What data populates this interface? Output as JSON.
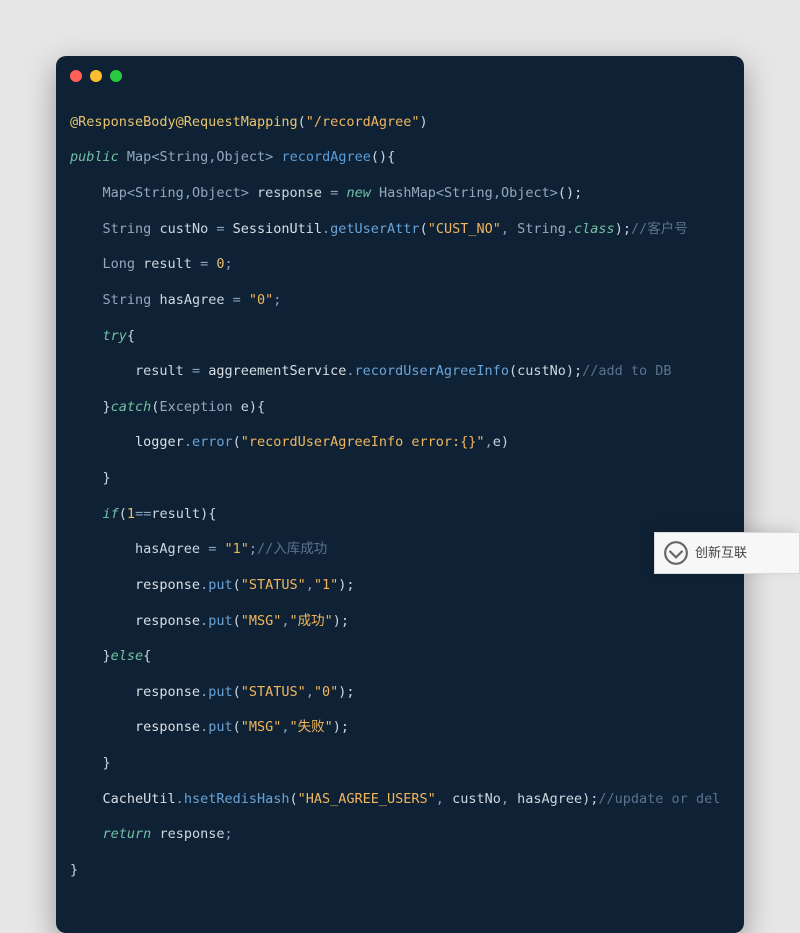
{
  "traffic_light_colors": {
    "red": "#ff5f56",
    "yellow": "#ffbd2e",
    "green": "#27c93f"
  },
  "code": {
    "l1": {
      "ann1": "@ResponseBody",
      "ann2": "@RequestMapping",
      "lp": "(",
      "str": "\"/recordAgree\"",
      "rp": ")"
    },
    "l2": {
      "pub": "public",
      "sp1": " ",
      "t1": "Map",
      "g1": "<",
      "t2": "String",
      "c1": ",",
      "t3": "Object",
      "g2": ">",
      "sp2": " ",
      "name": "recordAgree",
      "pp": "(){"
    },
    "l3": {
      "ind": "    ",
      "t1": "Map",
      "g1": "<",
      "t2": "String",
      "c1": ",",
      "t3": "Object",
      "g2": ">",
      "sp": " ",
      "v": "response",
      "eq": " = ",
      "nw": "new",
      "sp2": " ",
      "t4": "HashMap",
      "g3": "<",
      "t5": "String",
      "c2": ",",
      "t6": "Object",
      "g4": ">",
      "tail": "();"
    },
    "l4": {
      "ind": "    ",
      "t": "String",
      "sp": " ",
      "v": "custNo",
      "eq": " = ",
      "obj": "SessionUtil",
      "dot": ".",
      "call": "getUserAttr",
      "lp": "(",
      "s": "\"CUST_NO\"",
      "c": ", ",
      "t2": "String",
      "dot2": ".",
      "cl": "class",
      "rp": ");",
      "cmt": "//客户号"
    },
    "l5": {
      "ind": "    ",
      "t": "Long",
      "sp": " ",
      "v": "result",
      "eq": " = ",
      "n": "0",
      "sc": ";"
    },
    "l6": {
      "ind": "    ",
      "t": "String",
      "sp": " ",
      "v": "hasAgree",
      "eq": " = ",
      "s": "\"0\"",
      "sc": ";"
    },
    "l7": {
      "ind": "    ",
      "try": "try",
      "br": "{"
    },
    "l8": {
      "ind": "        ",
      "v": "result",
      "eq": " = ",
      "obj": "aggreementService",
      "dot": ".",
      "call": "recordUserAgreeInfo",
      "lp": "(",
      "arg": "custNo",
      "rp": ");",
      "cmt": "//add to DB"
    },
    "l9": {
      "ind": "    ",
      "rc": "}",
      "ct": "catch",
      "lp": "(",
      "t": "Exception",
      "sp": " ",
      "v": "e",
      "rp": "){"
    },
    "l10": {
      "ind": "        ",
      "obj": "logger",
      "dot": ".",
      "call": "error",
      "lp": "(",
      "s": "\"recordUserAgreeInfo error:{}\"",
      "c": ",",
      "arg": "e",
      "rp": ")"
    },
    "l11": {
      "ind": "    ",
      "br": "}"
    },
    "l12": {
      "ind": "    ",
      "if": "if",
      "lp": "(",
      "n": "1",
      "eq": "==",
      "v": "result",
      "rp": "){"
    },
    "l13": {
      "ind": "        ",
      "v": "hasAgree",
      "eq": " = ",
      "s": "\"1\"",
      "sc": ";",
      "cmt": "//入库成功"
    },
    "l14": {
      "ind": "        ",
      "obj": "response",
      "dot": ".",
      "call": "put",
      "lp": "(",
      "s1": "\"STATUS\"",
      "c": ",",
      "s2": "\"1\"",
      "rp": ");"
    },
    "l15": {
      "ind": "        ",
      "obj": "response",
      "dot": ".",
      "call": "put",
      "lp": "(",
      "s1": "\"MSG\"",
      "c": ",",
      "s2": "\"成功\"",
      "rp": ");"
    },
    "l16": {
      "ind": "    ",
      "rc": "}",
      "el": "else",
      "br": "{"
    },
    "l17": {
      "ind": "        ",
      "obj": "response",
      "dot": ".",
      "call": "put",
      "lp": "(",
      "s1": "\"STATUS\"",
      "c": ",",
      "s2": "\"0\"",
      "rp": ");"
    },
    "l18": {
      "ind": "        ",
      "obj": "response",
      "dot": ".",
      "call": "put",
      "lp": "(",
      "s1": "\"MSG\"",
      "c": ",",
      "s2": "\"失败\"",
      "rp": ");"
    },
    "l19": {
      "ind": "    ",
      "br": "}"
    },
    "l20": {
      "ind": "    ",
      "obj": "CacheUtil",
      "dot": ".",
      "call": "hsetRedisHash",
      "lp": "(",
      "s": "\"HAS_AGREE_USERS\"",
      "c1": ", ",
      "a1": "custNo",
      "c2": ", ",
      "a2": "hasAgree",
      "rp": ");",
      "cmt": "//update or del"
    },
    "l21": {
      "ind": "    ",
      "ret": "return",
      "sp": " ",
      "v": "response",
      "sc": ";"
    },
    "l22": {
      "br": "}"
    }
  },
  "watermark": {
    "text": "创新互联"
  }
}
